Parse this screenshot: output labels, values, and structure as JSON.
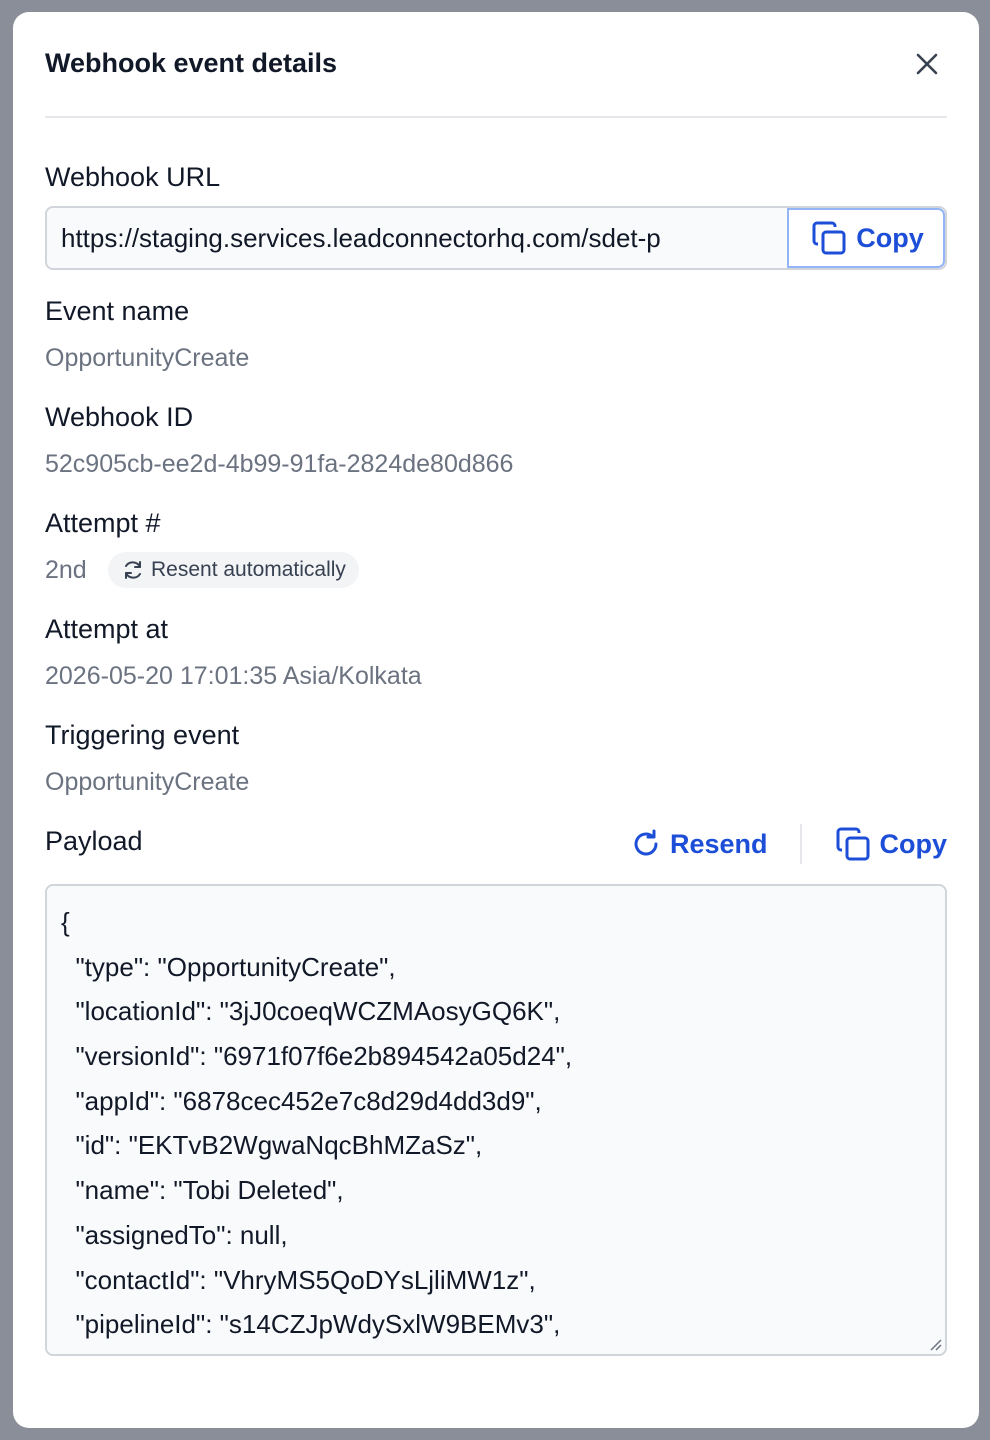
{
  "modal": {
    "title": "Webhook event details"
  },
  "webhook_url": {
    "label": "Webhook URL",
    "value": "https://staging.services.leadconnectorhq.com/sdet-p",
    "copy_label": "Copy"
  },
  "event_name": {
    "label": "Event name",
    "value": "OpportunityCreate"
  },
  "webhook_id": {
    "label": "Webhook ID",
    "value": "52c905cb-ee2d-4b99-91fa-2824de80d866"
  },
  "attempt": {
    "label": "Attempt #",
    "value": "2nd",
    "badge": "Resent automatically"
  },
  "attempt_at": {
    "label": "Attempt at",
    "value": "2026-05-20 17:01:35 Asia/Kolkata"
  },
  "triggering_event": {
    "label": "Triggering event",
    "value": "OpportunityCreate"
  },
  "payload": {
    "label": "Payload",
    "resend_label": "Resend",
    "copy_label": "Copy",
    "lines": [
      "{",
      "  \"type\": \"OpportunityCreate\",",
      "  \"locationId\": \"3jJ0coeqWCZMAosyGQ6K\",",
      "  \"versionId\": \"6971f07f6e2b894542a05d24\",",
      "  \"appId\": \"6878cec452e7c8d29d4dd3d9\",",
      "  \"id\": \"EKTvB2WgwaNqcBhMZaSz\",",
      "  \"name\": \"Tobi Deleted\",",
      "  \"assignedTo\": null,",
      "  \"contactId\": \"VhryMS5QoDYsLjliMW1z\",",
      "  \"pipelineId\": \"s14CZJpWdySxlW9BEMv3\","
    ]
  },
  "colors": {
    "accent": "#1d4ed8",
    "text_primary": "#111827",
    "text_muted": "#6b7280",
    "overlay": "#8a8e99"
  }
}
